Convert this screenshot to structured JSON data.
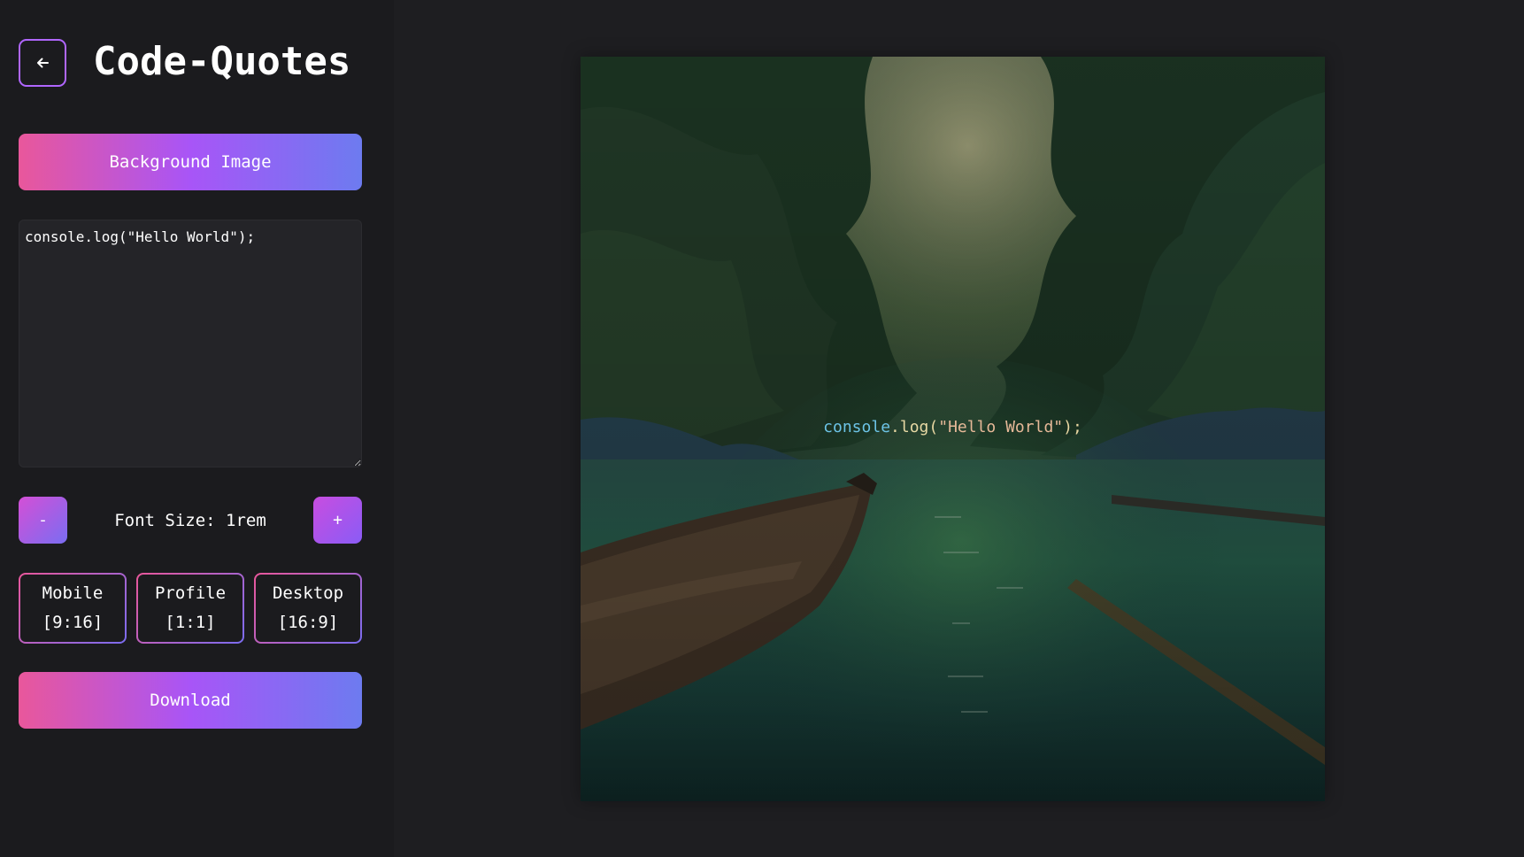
{
  "header": {
    "title": "Code-Quotes",
    "back_icon": "arrow-left-icon"
  },
  "controls": {
    "background_button": "Background Image",
    "code_text": "console.log(\"Hello World\");",
    "font_size": {
      "minus_label": "-",
      "plus_label": "+",
      "label": "Font Size:",
      "value": "1rem"
    },
    "ratios": [
      {
        "name": "Mobile",
        "ratio": "[9:16]"
      },
      {
        "name": "Profile",
        "ratio": "[1:1]"
      },
      {
        "name": "Desktop",
        "ratio": "[16:9]"
      }
    ],
    "download_button": "Download"
  },
  "preview": {
    "code_tokens": {
      "object": "console",
      "dot": ".",
      "method": "log",
      "open": "(",
      "string": "\"Hello World\"",
      "close": ");"
    }
  },
  "colors": {
    "gradient_start": "#e9579b",
    "gradient_mid": "#a855f7",
    "gradient_end": "#6d7bf0",
    "background": "#1e1e21"
  }
}
